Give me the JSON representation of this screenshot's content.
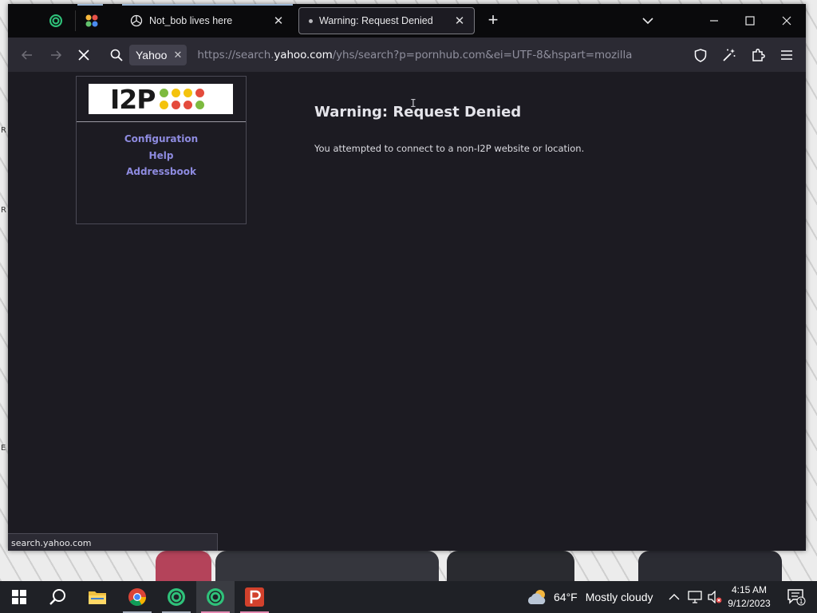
{
  "browser": {
    "tabs": [
      {
        "label": "Not_bob lives here",
        "active": false
      },
      {
        "label": "Warning: Request Denied",
        "active": true
      }
    ],
    "search_engine": "Yahoo",
    "url": {
      "prefix": "https://search.",
      "domain": "yahoo.com",
      "suffix": "/yhs/search?p=pornhub.com&ei=UTF-8&hspart=mozilla"
    },
    "status_url": "search.yahoo.com",
    "icons": {
      "back": "back-arrow-icon",
      "forward": "forward-arrow-icon",
      "stop": "stop-loading-icon",
      "search": "search-icon",
      "shield": "tracking-protection-shield-icon",
      "customize": "customize-wand-icon",
      "extensions": "extensions-puzzle-icon",
      "menu": "hamburger-menu-icon"
    }
  },
  "page": {
    "logo_text": "I2P",
    "logo_dot_colors": [
      "#7dba3f",
      "#f4c30d",
      "#f4c30d",
      "#e44b3c",
      "#f4c30d",
      "#e44b3c",
      "#e44b3c",
      "#7dba3f"
    ],
    "links": [
      "Configuration",
      "Help",
      "Addressbook"
    ],
    "title": "Warning: Request Denied",
    "message": "You attempted to connect to a non-I2P website or location."
  },
  "taskbar": {
    "apps": [
      "start",
      "search",
      "file-explorer",
      "chrome",
      "tor-like-browser",
      "i2p-browser",
      "proxy-app"
    ],
    "weather": {
      "temp": "64°F",
      "condition": "Mostly cloudy"
    },
    "time": "4:15 AM",
    "date": "9/12/2023",
    "notification_count": "1"
  },
  "colors": {
    "page_bg": "#1c1b22",
    "toolbar_bg": "#2b2a33",
    "link": "#8e8be0",
    "tab_indicator": "#9bb7d8"
  }
}
